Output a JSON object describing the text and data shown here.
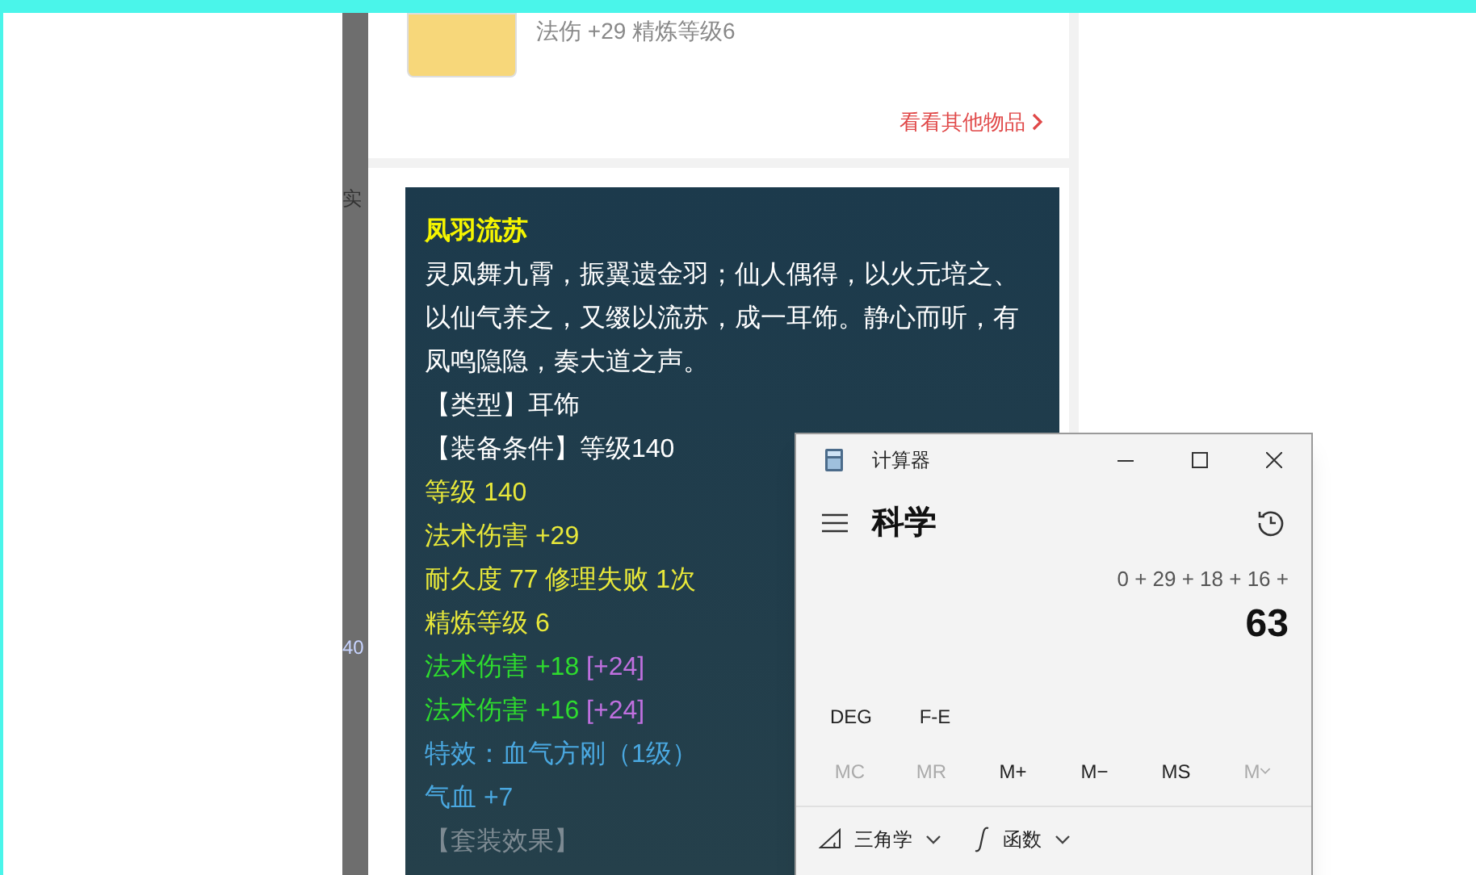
{
  "side_strip": {
    "fragments": [
      "实",
      "40"
    ]
  },
  "item_card": {
    "stats": "法伤 +29 精炼等级6",
    "link": "看看其他物品"
  },
  "tooltip": {
    "lines": [
      {
        "kind": "title",
        "text": "凤羽流苏"
      },
      {
        "kind": "desc",
        "text": "灵凤舞九霄，振翼遗金羽；仙人偶得，以火元培之、以仙气养之，又缀以流苏，成一耳饰。静心而听，有凤鸣隐隐，奏大道之声。"
      },
      {
        "kind": "info",
        "text": "【类型】耳饰"
      },
      {
        "kind": "info",
        "text": "【装备条件】等级140"
      },
      {
        "kind": "attr",
        "text": "等级 140"
      },
      {
        "kind": "attr",
        "text": "法术伤害 +29"
      },
      {
        "kind": "attr",
        "text": "耐久度 77 修理失败 1次"
      },
      {
        "kind": "attr",
        "text": "精炼等级 6"
      },
      {
        "kind": "bonus",
        "text": "法术伤害 +18",
        "extra": "[+24]"
      },
      {
        "kind": "bonus",
        "text": "法术伤害 +16",
        "extra": "[+24]"
      },
      {
        "kind": "effect",
        "text": "特效：血气方刚（1级）"
      },
      {
        "kind": "effect",
        "text": "气血 +7"
      },
      {
        "kind": "set",
        "text": "【套装效果】"
      }
    ]
  },
  "calculator": {
    "title": "计算器",
    "mode": "科学",
    "expression": "0 + 29 + 18 + 16 +",
    "result": "63",
    "angle_buttons": [
      {
        "label": "DEG"
      },
      {
        "label": "F-E"
      }
    ],
    "memory": [
      {
        "label": "MC",
        "disabled": true,
        "kind": "plain"
      },
      {
        "label": "MR",
        "disabled": true,
        "kind": "plain"
      },
      {
        "label": "M+",
        "disabled": false,
        "kind": "plain"
      },
      {
        "label": "M−",
        "disabled": false,
        "kind": "plain"
      },
      {
        "label": "MS",
        "disabled": false,
        "kind": "plain"
      },
      {
        "label": "M",
        "disabled": true,
        "kind": "menu"
      }
    ],
    "toolbar": [
      {
        "label": "三角学",
        "kind": "trig"
      },
      {
        "label": "函数",
        "kind": "func"
      }
    ]
  }
}
